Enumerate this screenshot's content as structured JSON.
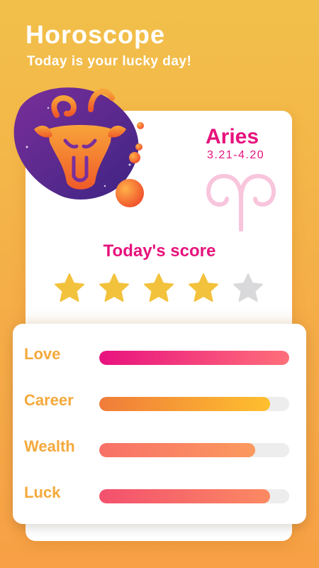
{
  "header": {
    "title": "Horoscope",
    "subtitle": "Today is your lucky day!"
  },
  "sign": {
    "name": "Aries",
    "dates": "3.21-4.20",
    "icon": "ram-head-icon",
    "symbol_icon": "aries-symbol-icon"
  },
  "score": {
    "title": "Today's score",
    "rating": 4,
    "max": 5
  },
  "metrics": [
    {
      "label": "Love",
      "value": 1.0,
      "colors": [
        "#e8127f",
        "#ff6f7a"
      ]
    },
    {
      "label": "Career",
      "value": 0.9,
      "colors": [
        "#f07c3a",
        "#fec02f"
      ]
    },
    {
      "label": "Wealth",
      "value": 0.82,
      "colors": [
        "#f87068",
        "#fb9a5e"
      ]
    },
    {
      "label": "Luck",
      "value": 0.9,
      "colors": [
        "#f3506e",
        "#fb8a62"
      ]
    }
  ],
  "colors": {
    "accent": "#e6127c",
    "label": "#f4a93c",
    "star_on": "#f3c23c",
    "star_off": "#d9d9dc",
    "blob": "#5a2a8c"
  }
}
